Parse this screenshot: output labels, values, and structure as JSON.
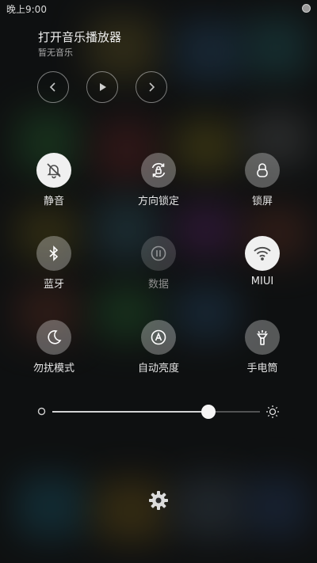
{
  "status_bar": {
    "time": "晚上9:00"
  },
  "music": {
    "title": "打开音乐播放器",
    "subtitle": "暂无音乐",
    "controls": [
      "previous-icon",
      "play-icon",
      "next-icon"
    ]
  },
  "tiles": [
    {
      "label": "静音",
      "icon": "bell-off-icon",
      "active": true
    },
    {
      "label": "方向锁定",
      "icon": "rotation-lock-icon",
      "active": false
    },
    {
      "label": "锁屏",
      "icon": "lock-icon",
      "active": false
    },
    {
      "label": "蓝牙",
      "icon": "bluetooth-icon",
      "active": false
    },
    {
      "label": "数据",
      "icon": "mobile-data-icon",
      "active": false,
      "disabled": true
    },
    {
      "label": "MIUI",
      "icon": "wifi-icon",
      "active": true
    },
    {
      "label": "勿扰模式",
      "icon": "moon-icon",
      "active": false
    },
    {
      "label": "自动亮度",
      "icon": "auto-brightness-icon",
      "active": false
    },
    {
      "label": "手电筒",
      "icon": "flashlight-icon",
      "active": false
    }
  ],
  "brightness": {
    "level_percent": 75
  },
  "colors": {
    "active_tile": "#f0f0f0",
    "inactive_tile": "rgba(255,255,255,0.30)"
  }
}
